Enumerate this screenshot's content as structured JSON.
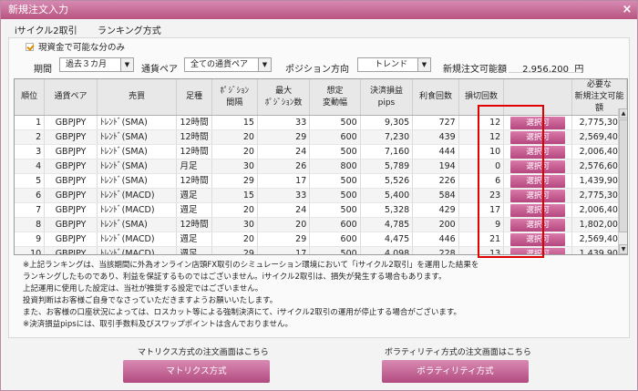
{
  "window": {
    "title": "新規注文入力",
    "close_glyph": "×"
  },
  "tabs": [
    {
      "label": "iサイクル2取引"
    },
    {
      "label": "ランキング方式"
    }
  ],
  "option": {
    "own_funds_label": "現資金で可能な分のみ",
    "checked": true
  },
  "filters": {
    "period_label": "期間",
    "period_value": "過去３カ月",
    "pair_label": "通貨ペア",
    "pair_value": "全ての通貨ペア",
    "position_label": "ポジション方向",
    "position_value": "トレンド",
    "available_label": "新規注文可能額",
    "available_value": "2,956,200",
    "available_unit": "円",
    "arrow_glyph": "▼"
  },
  "table": {
    "headers": [
      "順位",
      "通貨ペア",
      "売買",
      "足種",
      "ﾎﾟｼﾞｼｮﾝ\n間隔",
      "最大\nﾎﾟｼﾞｼｮﾝ数",
      "想定\n変動幅",
      "決済損益\npips",
      "利食回数",
      "損切回数",
      "",
      "必要な\n新規注文可能額"
    ],
    "select_label": "選択可",
    "rows": [
      {
        "rank": "1",
        "pair": "GBPJPY",
        "trade": "ﾄﾚﾝﾄﾞ(SMA)",
        "bar": "12時間",
        "interval": "15",
        "max": "33",
        "range": "500",
        "pips": "9,305",
        "tp": "727",
        "sl": "12",
        "required": "2,775,300"
      },
      {
        "rank": "2",
        "pair": "GBPJPY",
        "trade": "ﾄﾚﾝﾄﾞ(SMA)",
        "bar": "12時間",
        "interval": "20",
        "max": "29",
        "range": "600",
        "pips": "7,230",
        "tp": "439",
        "sl": "12",
        "required": "2,569,400"
      },
      {
        "rank": "3",
        "pair": "GBPJPY",
        "trade": "ﾄﾚﾝﾄﾞ(SMA)",
        "bar": "12時間",
        "interval": "20",
        "max": "24",
        "range": "500",
        "pips": "7,160",
        "tp": "444",
        "sl": "10",
        "required": "2,006,400"
      },
      {
        "rank": "4",
        "pair": "GBPJPY",
        "trade": "ﾄﾚﾝﾄﾞ(SMA)",
        "bar": "月足",
        "interval": "30",
        "max": "26",
        "range": "800",
        "pips": "5,789",
        "tp": "194",
        "sl": "0",
        "required": "2,576,600"
      },
      {
        "rank": "5",
        "pair": "GBPJPY",
        "trade": "ﾄﾚﾝﾄﾞ(SMA)",
        "bar": "12時間",
        "interval": "29",
        "max": "17",
        "range": "500",
        "pips": "5,526",
        "tp": "226",
        "sl": "6",
        "required": "1,439,900"
      },
      {
        "rank": "6",
        "pair": "GBPJPY",
        "trade": "ﾄﾚﾝﾄﾞ(MACD)",
        "bar": "週足",
        "interval": "15",
        "max": "33",
        "range": "500",
        "pips": "5,400",
        "tp": "584",
        "sl": "23",
        "required": "2,775,300"
      },
      {
        "rank": "7",
        "pair": "GBPJPY",
        "trade": "ﾄﾚﾝﾄﾞ(MACD)",
        "bar": "週足",
        "interval": "20",
        "max": "24",
        "range": "500",
        "pips": "5,328",
        "tp": "429",
        "sl": "17",
        "required": "2,006,400"
      },
      {
        "rank": "8",
        "pair": "GBPJPY",
        "trade": "ﾄﾚﾝﾄﾞ(SMA)",
        "bar": "12時間",
        "interval": "30",
        "max": "20",
        "range": "600",
        "pips": "4,785",
        "tp": "200",
        "sl": "9",
        "required": "1,802,000"
      },
      {
        "rank": "9",
        "pair": "GBPJPY",
        "trade": "ﾄﾚﾝﾄﾞ(MACD)",
        "bar": "週足",
        "interval": "20",
        "max": "29",
        "range": "600",
        "pips": "4,475",
        "tp": "446",
        "sl": "21",
        "required": "2,569,400"
      },
      {
        "rank": "10",
        "pair": "GBPJPY",
        "trade": "ﾄﾚﾝﾄﾞ(MACD)",
        "bar": "週足",
        "interval": "29",
        "max": "17",
        "range": "500",
        "pips": "4,098",
        "tp": "228",
        "sl": "13",
        "required": "1,439,900"
      }
    ]
  },
  "notes": [
    "※上記ランキングは、当該期間に外為オンライン店頭FX取引のシミュレーション環境において「iサイクル2取引」を運用した結果を",
    "ランキングしたものであり、利益を保証するものではございません。iサイクル2取引は、損失が発生する場合もあります。",
    "上記運用に使用した設定は、当社が推奨する設定ではございません。",
    "投資判断はお客様ご自身でなさっていただきますようお願いいたします。",
    "また、お客様の口座状況によっては、ロスカット等による強制決済にて、iサイクル2取引の運用が停止する場合がございます。",
    "※決済損益pipsには、取引手数料及びスワップポイントは含んでおりません。"
  ],
  "footer": {
    "matrix_caption": "マトリクス方式の注文画面はこちら",
    "matrix_button": "マトリクス方式",
    "vol_caption": "ボラティリティ方式の注文画面はこちら",
    "vol_button": "ボラティリティ方式"
  },
  "scroll": {
    "up_glyph": "▲",
    "down_glyph": "▼"
  }
}
